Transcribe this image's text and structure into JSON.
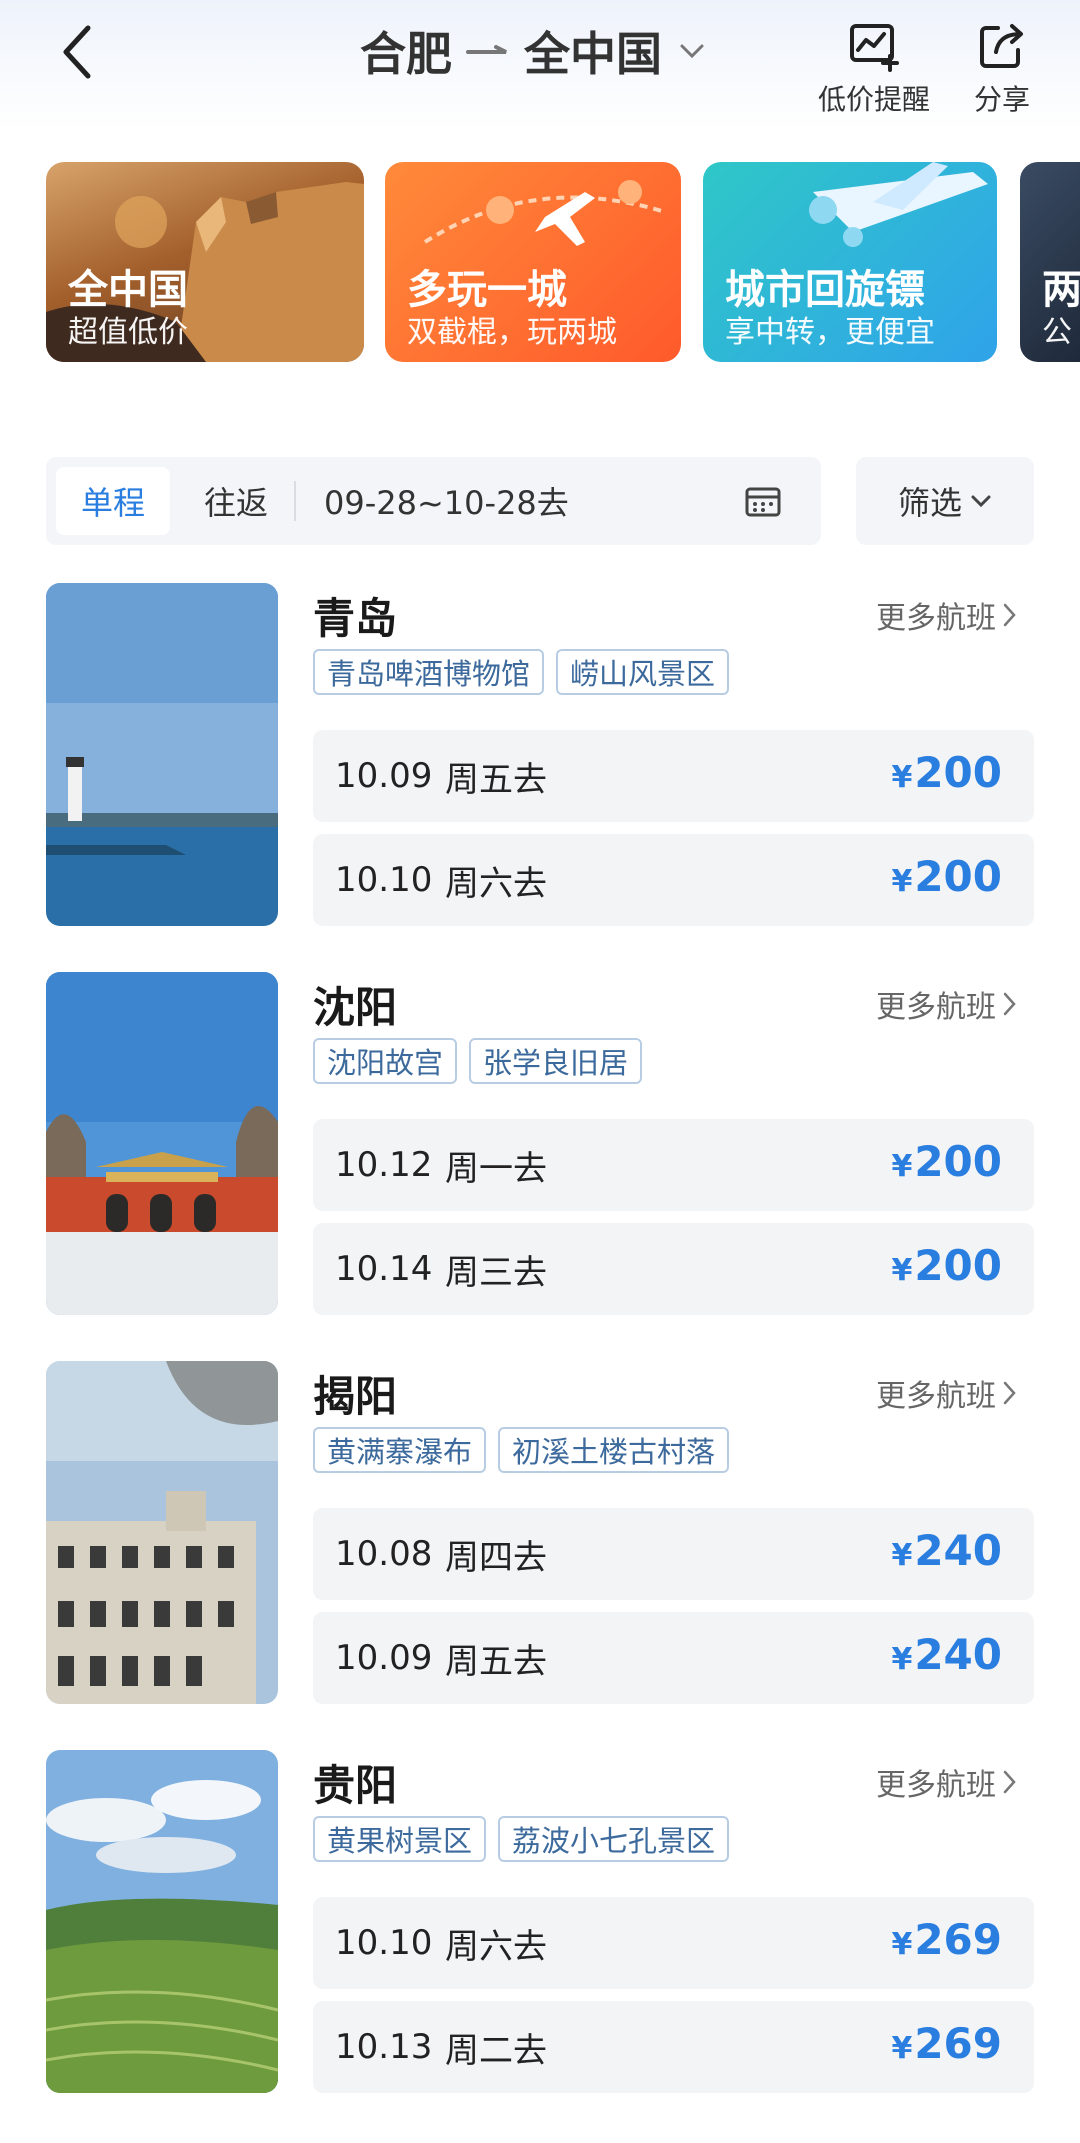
{
  "header": {
    "origin": "合肥",
    "destination": "全中国",
    "alert_label": "低价提醒",
    "share_label": "分享"
  },
  "banners": [
    {
      "title": "全中国",
      "subtitle": "超值低价"
    },
    {
      "title": "多玩一城",
      "subtitle": "双截棍，玩两城"
    },
    {
      "title": "城市回旋镖",
      "subtitle": "享中转，更便宜"
    },
    {
      "title": "两",
      "subtitle": "公"
    }
  ],
  "filter": {
    "tab_oneway": "单程",
    "tab_roundtrip": "往返",
    "date_range": "09-28~10-28去",
    "filter_label": "筛选"
  },
  "destinations": [
    {
      "city": "青岛",
      "more": "更多航班",
      "tags": [
        "青岛啤酒博物馆",
        "崂山风景区"
      ],
      "flights": [
        {
          "date": "10.09",
          "day": "周五去",
          "currency": "¥",
          "price": "200"
        },
        {
          "date": "10.10",
          "day": "周六去",
          "currency": "¥",
          "price": "200"
        }
      ]
    },
    {
      "city": "沈阳",
      "more": "更多航班",
      "tags": [
        "沈阳故宫",
        "张学良旧居"
      ],
      "flights": [
        {
          "date": "10.12",
          "day": "周一去",
          "currency": "¥",
          "price": "200"
        },
        {
          "date": "10.14",
          "day": "周三去",
          "currency": "¥",
          "price": "200"
        }
      ]
    },
    {
      "city": "揭阳",
      "more": "更多航班",
      "tags": [
        "黄满寨瀑布",
        "初溪土楼古村落"
      ],
      "flights": [
        {
          "date": "10.08",
          "day": "周四去",
          "currency": "¥",
          "price": "240"
        },
        {
          "date": "10.09",
          "day": "周五去",
          "currency": "¥",
          "price": "240"
        }
      ]
    },
    {
      "city": "贵阳",
      "more": "更多航班",
      "tags": [
        "黄果树景区",
        "荔波小七孔景区"
      ],
      "flights": [
        {
          "date": "10.10",
          "day": "周六去",
          "currency": "¥",
          "price": "269"
        },
        {
          "date": "10.13",
          "day": "周二去",
          "currency": "¥",
          "price": "269"
        }
      ]
    }
  ],
  "colors": {
    "accent": "#2a7ee0",
    "tag_text": "#3d6a9c",
    "row_bg": "#f3f4f6"
  }
}
